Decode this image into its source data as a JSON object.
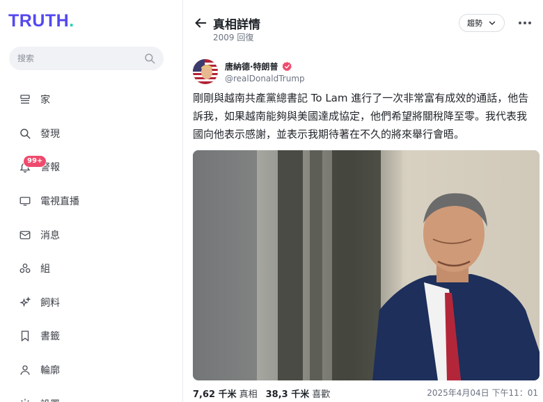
{
  "brand": {
    "name": "TRUTH",
    "dot": ".",
    "colors": {
      "logo": "#5448ee",
      "dot": "#1fd3b5",
      "badge": "#ef4a6d"
    }
  },
  "search": {
    "placeholder": "搜索"
  },
  "sidebar": {
    "items": [
      {
        "label": "家",
        "icon": "home-icon"
      },
      {
        "label": "發現",
        "icon": "search-icon"
      },
      {
        "label": "警報",
        "icon": "bell-icon",
        "badge": "99+"
      },
      {
        "label": "電視直播",
        "icon": "tv-icon"
      },
      {
        "label": "消息",
        "icon": "mail-icon"
      },
      {
        "label": "組",
        "icon": "groups-icon"
      },
      {
        "label": "飼料",
        "icon": "sparkle-icon"
      },
      {
        "label": "書籤",
        "icon": "bookmark-icon"
      },
      {
        "label": "輪廓",
        "icon": "profile-icon"
      },
      {
        "label": "設置",
        "icon": "gear-icon"
      }
    ]
  },
  "header": {
    "title": "真相詳情",
    "subtitle": "2009 回復",
    "sort_label": "趨勢"
  },
  "post": {
    "author": "唐納德·特朗普",
    "handle": "@realDonaldTrump",
    "text": "剛剛與越南共產黨總書記 To Lam 進行了一次非常富有成效的通話，他告訴我，如果越南能夠與美國達成協定，他們希望將關稅降至零。我代表我國向他表示感謝，並表示我期待著在不久的將來舉行會晤。",
    "stats": {
      "truths_count": "7,62 千米",
      "truths_label": "真相",
      "likes_count": "38,3 千米",
      "likes_label": "喜歡"
    },
    "timestamp": "2025年4月04日 下午11：01"
  }
}
